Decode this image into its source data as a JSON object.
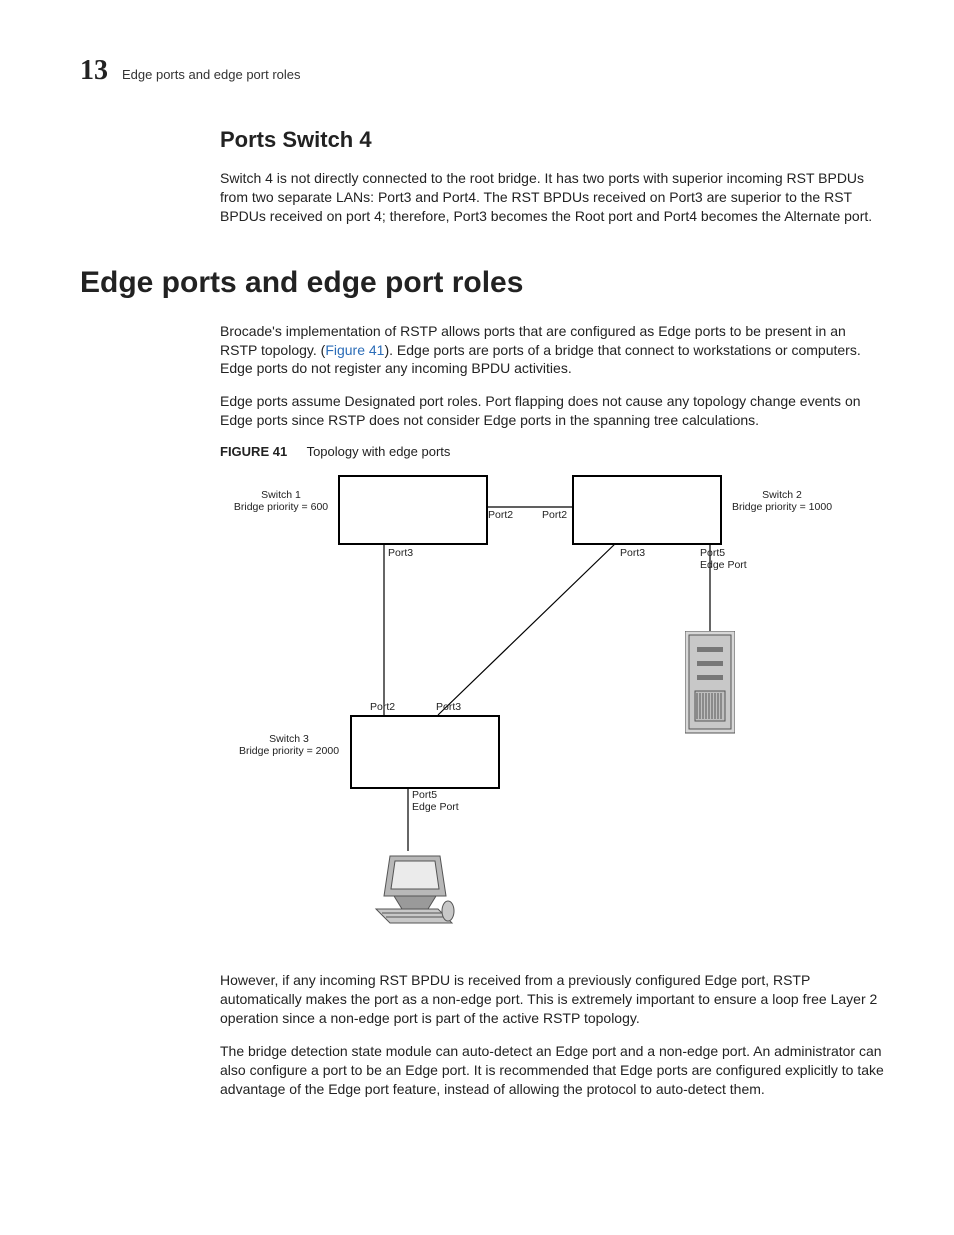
{
  "header": {
    "chapter_number": "13",
    "running_title": "Edge ports and edge port roles"
  },
  "sections": {
    "ports_switch_4": {
      "heading": "Ports Switch 4",
      "para1": "Switch 4 is not directly connected to the root bridge. It has two ports with superior incoming RST BPDUs from two separate LANs: Port3 and Port4. The RST BPDUs received on Port3 are superior to the RST BPDUs received on port 4; therefore, Port3 becomes the Root port and Port4 becomes the Alternate port."
    },
    "edge_ports": {
      "heading": "Edge ports and edge port roles",
      "para1_a": "Brocade's implementation of RSTP allows ports that are configured as Edge ports to be present in an RSTP topology. (",
      "para1_ref": "Figure 41",
      "para1_b": "). Edge ports are ports of a bridge that connect to workstations or computers. Edge ports do not register any incoming BPDU activities.",
      "para2": "Edge ports assume Designated port roles.  Port flapping does not cause any topology change events on Edge ports since RSTP does not consider Edge ports in the spanning tree calculations.",
      "figure": {
        "label": "FIGURE 41",
        "title": "Topology with edge ports",
        "labels": {
          "switch1_name": "Switch 1",
          "switch1_priority": "Bridge priority = 600",
          "switch2_name": "Switch 2",
          "switch2_priority": "Bridge priority = 1000",
          "switch3_name": "Switch 3",
          "switch3_priority": "Bridge priority = 2000",
          "sw1_port2": "Port2",
          "sw1_port3": "Port3",
          "sw2_port2": "Port2",
          "sw2_port3": "Port3",
          "sw2_port5": "Port5",
          "sw2_edge": "Edge Port",
          "sw3_port2": "Port2",
          "sw3_port3": "Port3",
          "sw3_port5": "Port5",
          "sw3_edge": "Edge Port"
        }
      },
      "para3": "However, if any incoming RST BPDU is received from a previously configured Edge port, RSTP automatically makes the port as a non-edge port. This is extremely important to ensure a loop free Layer 2 operation since a non-edge port is part of the active RSTP topology.",
      "para4": "The bridge detection state module can auto-detect an Edge port and a non-edge port.  An administrator can also configure a port to be an Edge port.  It is recommended that Edge ports are configured explicitly to take advantage of the Edge port feature, instead of allowing the protocol to auto-detect them."
    }
  }
}
